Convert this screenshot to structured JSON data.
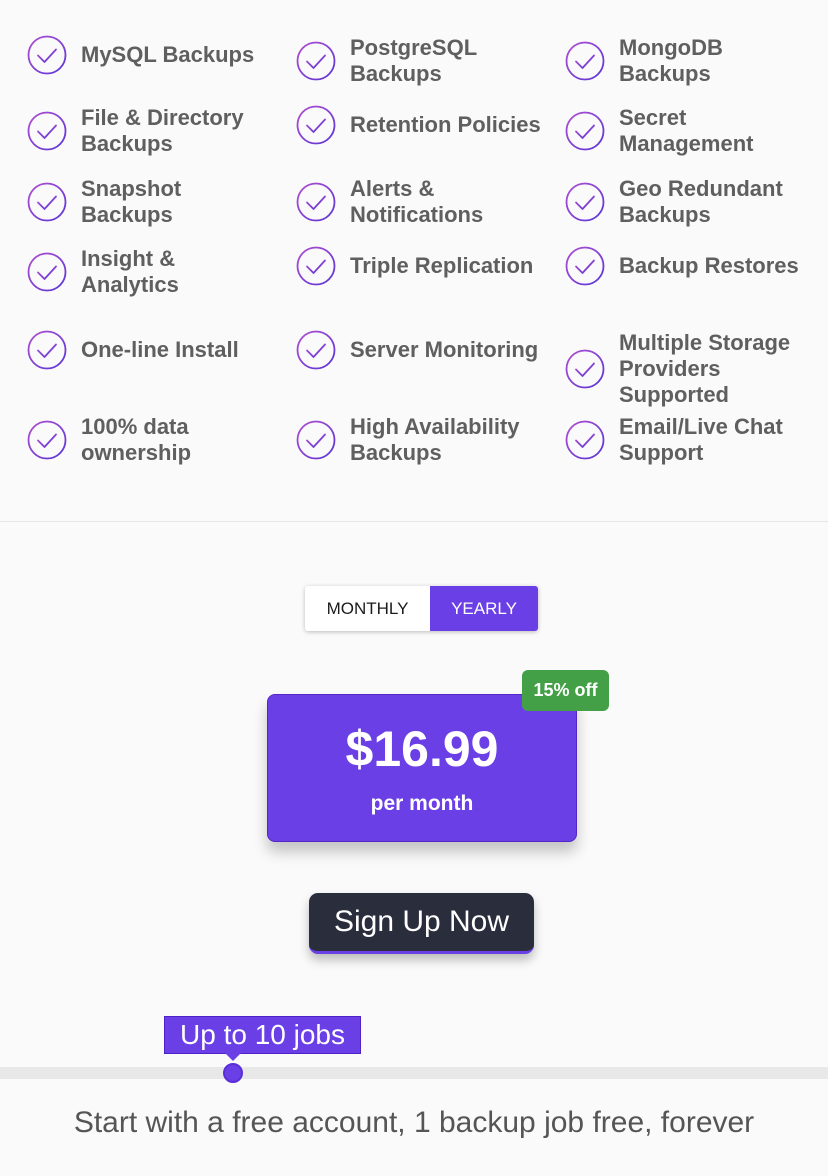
{
  "features": [
    [
      "MySQL Backups"
    ],
    [
      "PostgreSQL",
      "Backups"
    ],
    [
      "MongoDB",
      "Backups"
    ],
    [
      "File & Directory",
      "Backups"
    ],
    [
      "Retention Policies"
    ],
    [
      "Secret",
      "Management"
    ],
    [
      "Snapshot",
      "Backups"
    ],
    [
      "Alerts &",
      "Notifications"
    ],
    [
      "Geo Redundant",
      "Backups"
    ],
    [
      "Insight &",
      "Analytics"
    ],
    [
      "Triple Replication"
    ],
    [
      "Backup Restores"
    ],
    [
      "One-line Install"
    ],
    [
      "Server Monitoring"
    ],
    [
      "Multiple Storage",
      "Providers",
      "Supported"
    ],
    [
      "100% data",
      "ownership"
    ],
    [
      "High Availability",
      "Backups"
    ],
    [
      "Email/Live Chat",
      "Support"
    ]
  ],
  "billing_toggle": {
    "monthly_label": "MONTHLY",
    "yearly_label": "YEARLY",
    "selected": "YEARLY"
  },
  "pricing": {
    "price": "$16.99",
    "period": "per month",
    "discount_badge": "15% off"
  },
  "signup_button": "Sign Up Now",
  "jobs_slider": {
    "tooltip": "Up to 10 jobs",
    "value_fraction": 0.28
  },
  "free_account_text": "Start with a free account, 1 backup job free, forever",
  "colors": {
    "accent": "#6b3fe6",
    "check_gradient_start": "#b04fd1",
    "check_gradient_end": "#5a35d6",
    "discount_green": "#43a047",
    "signup_dark": "#2a2d3c"
  },
  "icons": {
    "feature_icon": "checkmark-circle-icon"
  }
}
